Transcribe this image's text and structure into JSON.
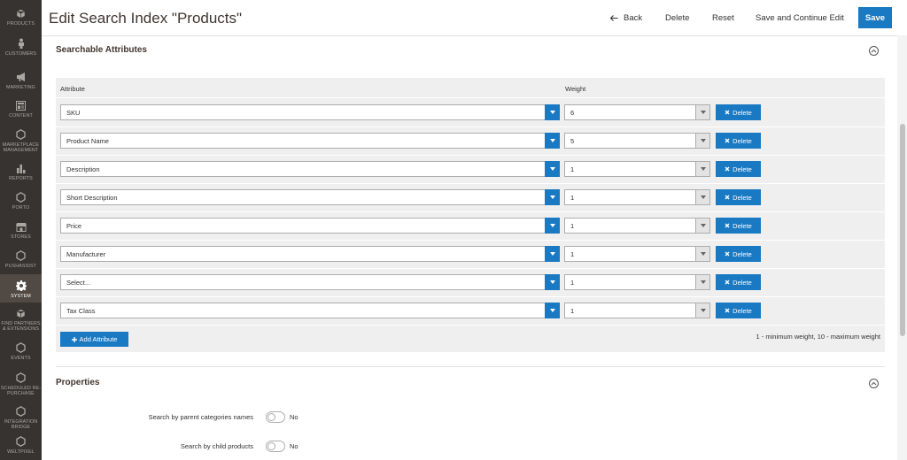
{
  "sidebar": {
    "items": [
      {
        "label": "PRODUCTS",
        "icon": "cube-icon"
      },
      {
        "label": "CUSTOMERS",
        "icon": "person-icon"
      },
      {
        "label": "MARKETING",
        "icon": "megaphone-icon"
      },
      {
        "label": "CONTENT",
        "icon": "layout-icon"
      },
      {
        "label": "MARKETPLACE MANAGEMENT",
        "icon": "hexagon-icon"
      },
      {
        "label": "REPORTS",
        "icon": "bar-chart-icon"
      },
      {
        "label": "PORTO",
        "icon": "hexagon-icon"
      },
      {
        "label": "STORES",
        "icon": "store-icon"
      },
      {
        "label": "PUSHASSIST",
        "icon": "hexagon-icon"
      },
      {
        "label": "SYSTEM",
        "icon": "gear-icon"
      },
      {
        "label": "FIND PARTNERS & EXTENSIONS",
        "icon": "box-icon"
      },
      {
        "label": "EVENTS",
        "icon": "hexagon-icon"
      },
      {
        "label": "SCHEDULED RE-PURCHASE",
        "icon": "hexagon-icon"
      },
      {
        "label": "INTEGRATION BRIDGE",
        "icon": "hexagon-icon"
      },
      {
        "label": "WELTPIXEL",
        "icon": "hexagon-icon"
      }
    ],
    "active_index": 9
  },
  "header": {
    "title": "Edit Search Index \"Products\"",
    "back_label": "Back",
    "delete_label": "Delete",
    "reset_label": "Reset",
    "save_continue_label": "Save and Continue Edit",
    "save_label": "Save"
  },
  "searchable_attributes": {
    "title": "Searchable Attributes",
    "col_attribute": "Attribute",
    "col_weight": "Weight",
    "rows": [
      {
        "attribute": "SKU",
        "weight": "6",
        "delete_label": "Delete"
      },
      {
        "attribute": "Product Name",
        "weight": "5",
        "delete_label": "Delete"
      },
      {
        "attribute": "Description",
        "weight": "1",
        "delete_label": "Delete"
      },
      {
        "attribute": "Short Description",
        "weight": "1",
        "delete_label": "Delete"
      },
      {
        "attribute": "Price",
        "weight": "1",
        "delete_label": "Delete"
      },
      {
        "attribute": "Manufacturer",
        "weight": "1",
        "delete_label": "Delete"
      },
      {
        "attribute": "Select...",
        "weight": "1",
        "delete_label": "Delete"
      },
      {
        "attribute": "Tax Class",
        "weight": "1",
        "delete_label": "Delete"
      }
    ],
    "add_label": "Add Attribute",
    "hint": "1 - minimum weight, 10 - maximum weight"
  },
  "properties": {
    "title": "Properties",
    "fields": [
      {
        "label": "Search by parent categories names",
        "value": "No"
      },
      {
        "label": "Search by child products",
        "value": "No"
      }
    ]
  },
  "colors": {
    "accent": "#1979c3",
    "sidebar_bg": "#373330",
    "sidebar_active": "#514943"
  }
}
